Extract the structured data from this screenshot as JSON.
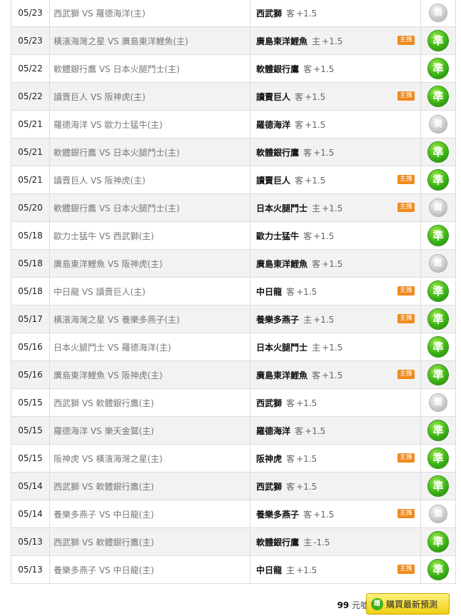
{
  "rows": [
    {
      "date": "05/23",
      "match": "西武獅 VS 羅德海洋(主)",
      "team": "西武獅",
      "ha": "客",
      "line": "+1.5",
      "badge": "",
      "result": "hit_miss"
    },
    {
      "date": "05/23",
      "match": "橫濱海灣之星 VS 廣島東洋鯉魚(主)",
      "team": "廣島東洋鯉魚",
      "ha": "主",
      "line": "+1.5",
      "badge": "主推",
      "result": "hit"
    },
    {
      "date": "05/22",
      "match": "軟體銀行鷹 VS 日本火腿鬥士(主)",
      "team": "軟體銀行鷹",
      "ha": "客",
      "line": "+1.5",
      "badge": "",
      "result": "hit"
    },
    {
      "date": "05/22",
      "match": "讀賣巨人 VS 阪神虎(主)",
      "team": "讀賣巨人",
      "ha": "客",
      "line": "+1.5",
      "badge": "主推",
      "result": "hit"
    },
    {
      "date": "05/21",
      "match": "羅德海洋 VS 歐力士猛牛(主)",
      "team": "羅德海洋",
      "ha": "客",
      "line": "+1.5",
      "badge": "",
      "result": "miss"
    },
    {
      "date": "05/21",
      "match": "軟體銀行鷹 VS 日本火腿鬥士(主)",
      "team": "軟體銀行鷹",
      "ha": "客",
      "line": "+1.5",
      "badge": "",
      "result": "hit"
    },
    {
      "date": "05/21",
      "match": "讀賣巨人 VS 阪神虎(主)",
      "team": "讀賣巨人",
      "ha": "客",
      "line": "+1.5",
      "badge": "主推",
      "result": "hit"
    },
    {
      "date": "05/20",
      "match": "軟體銀行鷹 VS 日本火腿鬥士(主)",
      "team": "日本火腿鬥士",
      "ha": "主",
      "line": "+1.5",
      "badge": "主推",
      "result": "miss"
    },
    {
      "date": "05/18",
      "match": "歐力士猛牛 VS 西武獅(主)",
      "team": "歐力士猛牛",
      "ha": "客",
      "line": "+1.5",
      "badge": "",
      "result": "hit"
    },
    {
      "date": "05/18",
      "match": "廣島東洋鯉魚 VS 阪神虎(主)",
      "team": "廣島東洋鯉魚",
      "ha": "客",
      "line": "+1.5",
      "badge": "",
      "result": "miss"
    },
    {
      "date": "05/18",
      "match": "中日龍 VS 讀賣巨人(主)",
      "team": "中日龍",
      "ha": "客",
      "line": "+1.5",
      "badge": "主推",
      "result": "hit"
    },
    {
      "date": "05/17",
      "match": "橫濱海灣之星 VS 養樂多燕子(主)",
      "team": "養樂多燕子",
      "ha": "主",
      "line": "+1.5",
      "badge": "主推",
      "result": "hit"
    },
    {
      "date": "05/16",
      "match": "日本火腿鬥士 VS 羅德海洋(主)",
      "team": "日本火腿鬥士",
      "ha": "主",
      "line": "+1.5",
      "badge": "",
      "result": "hit"
    },
    {
      "date": "05/16",
      "match": "廣島東洋鯉魚 VS 阪神虎(主)",
      "team": "廣島東洋鯉魚",
      "ha": "客",
      "line": "+1.5",
      "badge": "主推",
      "result": "hit"
    },
    {
      "date": "05/15",
      "match": "西武獅 VS 軟體銀行鷹(主)",
      "team": "西武獅",
      "ha": "客",
      "line": "+1.5",
      "badge": "",
      "result": "miss"
    },
    {
      "date": "05/15",
      "match": "羅德海洋 VS 樂天金鷲(主)",
      "team": "羅德海洋",
      "ha": "客",
      "line": "+1.5",
      "badge": "",
      "result": "hit"
    },
    {
      "date": "05/15",
      "match": "阪神虎 VS 橫濱海灣之星(主)",
      "team": "阪神虎",
      "ha": "客",
      "line": "+1.5",
      "badge": "主推",
      "result": "hit"
    },
    {
      "date": "05/14",
      "match": "西武獅 VS 軟體銀行鷹(主)",
      "team": "西武獅",
      "ha": "客",
      "line": "+1.5",
      "badge": "",
      "result": "hit"
    },
    {
      "date": "05/14",
      "match": "養樂多燕子 VS 中日龍(主)",
      "team": "養樂多燕子",
      "ha": "客",
      "line": "+1.5",
      "badge": "主推",
      "result": "miss"
    },
    {
      "date": "05/13",
      "match": "西武獅 VS 軟體銀行鷹(主)",
      "team": "軟體銀行鷹",
      "ha": "主",
      "line": "-1.5",
      "badge": "",
      "result": "hit"
    },
    {
      "date": "05/13",
      "match": "養樂多燕子 VS 中日龍(主)",
      "team": "中日龍",
      "ha": "主",
      "line": "+1.5",
      "badge": "主推",
      "result": "hit"
    }
  ],
  "result_labels": {
    "hit": "準",
    "miss": "閎"
  },
  "footer": {
    "price_amount": "99",
    "price_unit": "元噓幣",
    "buy_label": "購買最新預測",
    "buy_icon": "贈"
  },
  "colors": {
    "hit": "#3cb515",
    "miss": "#c9c9c9",
    "badge": "#f08a1c",
    "button": "#f0cf12"
  }
}
